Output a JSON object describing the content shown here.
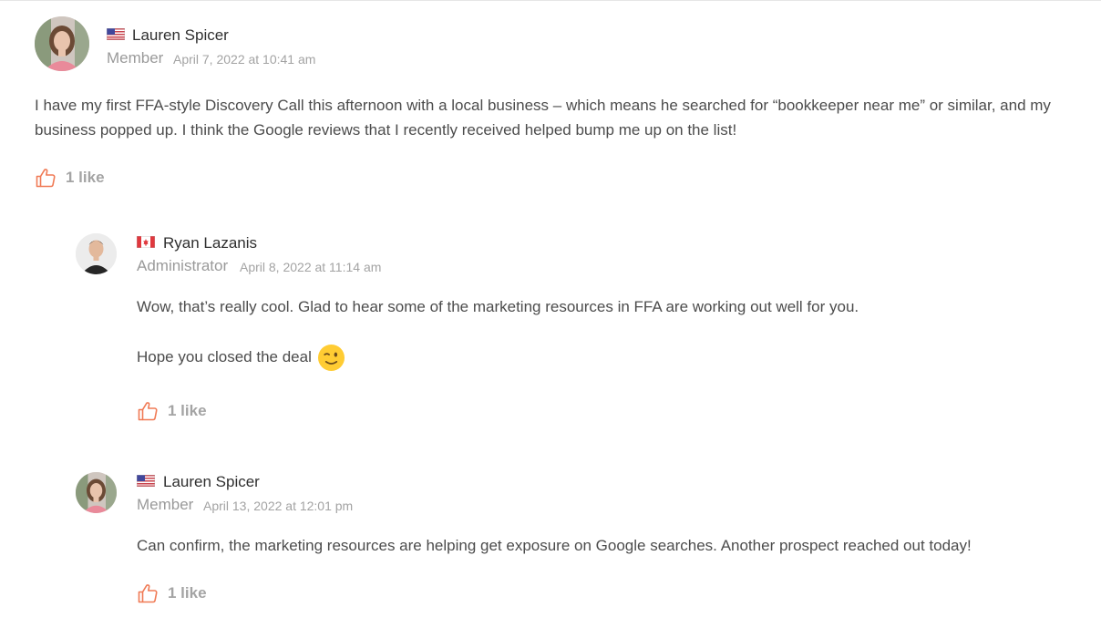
{
  "comments": [
    {
      "author": "Lauren Spicer",
      "flag": "us-flag",
      "role": "Member",
      "date": "April 7, 2022 at 10:41 am",
      "paragraphs": [
        "I have my first FFA-style Discovery Call this afternoon with a local business – which means he searched for “bookkeeper near me” or similar, and my business popped up. I think the Google reviews that I recently received helped bump me up on the list!"
      ],
      "likes": "1 like"
    },
    {
      "author": "Ryan Lazanis",
      "flag": "canada-flag",
      "role": "Administrator",
      "date": "April 8, 2022 at 11:14 am",
      "paragraphs": [
        "Wow, that’s really cool. Glad to hear some of the marketing resources in FFA are working out well for you.",
        "Hope you closed the deal"
      ],
      "emoji": "winking-face-emoji",
      "likes": "1 like"
    },
    {
      "author": "Lauren Spicer",
      "flag": "us-flag",
      "role": "Member",
      "date": "April 13, 2022 at 12:01 pm",
      "paragraphs": [
        "Can confirm, the marketing resources are helping get exposure on Google searches. Another prospect reached out today!"
      ],
      "likes": "1 like"
    }
  ],
  "colors": {
    "like_accent": "#f07a55",
    "muted_text": "#a3a3a3",
    "body_text": "#4c4c4c"
  }
}
